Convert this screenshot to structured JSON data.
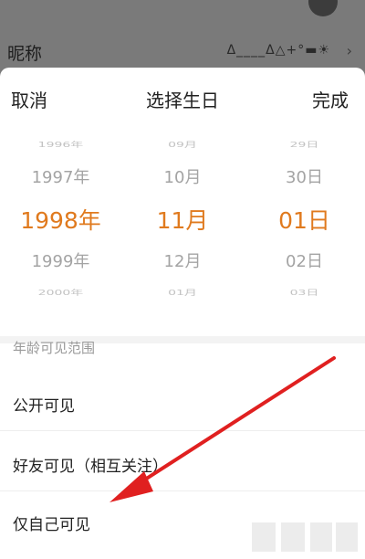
{
  "background": {
    "nickname_label": "昵称",
    "nickname_value": "Δ____Δ△+°▬☀",
    "chevron_icon": "chevron-right-icon"
  },
  "sheet": {
    "cancel_label": "取消",
    "title": "选择生日",
    "done_label": "完成"
  },
  "picker": {
    "years": [
      "1996年",
      "1997年",
      "1998年",
      "1999年",
      "2000年"
    ],
    "months": [
      "09月",
      "10月",
      "11月",
      "12月",
      "01月"
    ],
    "days": [
      "29日",
      "30日",
      "01日",
      "02日",
      "03日"
    ],
    "selected_index": 2,
    "selected_color": "#e07a1e"
  },
  "age_visibility": {
    "section_title": "年龄可见范围",
    "options": [
      "公开可见",
      "好友可见（相互关注）",
      "仅自己可见"
    ]
  },
  "annotation": {
    "color": "#e02020"
  }
}
